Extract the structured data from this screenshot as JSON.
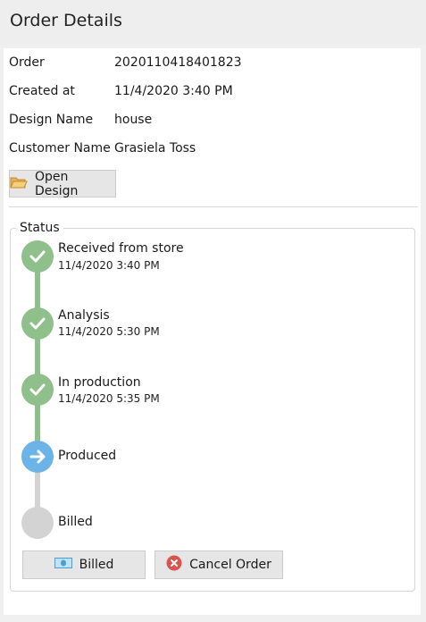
{
  "header": {
    "title": "Order Details"
  },
  "details": {
    "order_label": "Order",
    "order_value": "2020110418401823",
    "created_label": "Created at",
    "created_value": "11/4/2020 3:40 PM",
    "design_label": "Design Name",
    "design_value": "house",
    "customer_label": "Customer Name",
    "customer_value": "Grasiela Toss"
  },
  "actions": {
    "open_design_label": "Open Design"
  },
  "status": {
    "legend": "Status",
    "steps": [
      {
        "label": "Received from store",
        "time": "11/4/2020 3:40 PM",
        "state": "done"
      },
      {
        "label": "Analysis",
        "time": "11/4/2020 5:30 PM",
        "state": "done"
      },
      {
        "label": "In production",
        "time": "11/4/2020 5:35 PM",
        "state": "done"
      },
      {
        "label": "Produced",
        "time": "",
        "state": "current"
      },
      {
        "label": "Billed",
        "time": "",
        "state": "pending"
      }
    ],
    "billed_button_label": "Billed",
    "cancel_button_label": "Cancel Order"
  },
  "colors": {
    "done": "#8fbf8a",
    "current": "#6cb4e8",
    "pending": "#d3d3d3",
    "cancel": "#d9534f"
  },
  "icons": {
    "open_design": "folder-icon",
    "done": "check-icon",
    "current": "arrow-right-icon",
    "billed": "money-icon",
    "cancel": "cancel-icon"
  }
}
